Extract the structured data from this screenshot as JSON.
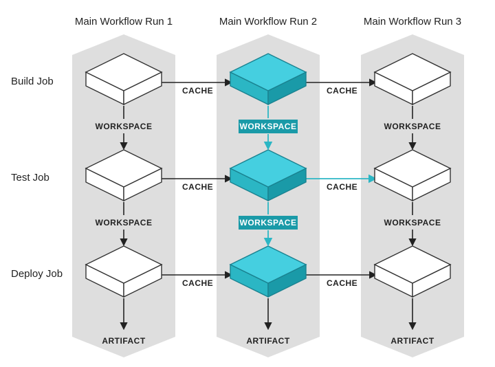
{
  "columns": [
    {
      "header": "Main Workflow Run 1"
    },
    {
      "header": "Main Workflow Run 2"
    },
    {
      "header": "Main Workflow Run 3"
    }
  ],
  "rows": [
    {
      "label": "Build Job"
    },
    {
      "label": "Test Job"
    },
    {
      "label": "Deploy Job"
    }
  ],
  "labels": {
    "cache": "CACHE",
    "workspace": "WORKSPACE",
    "artifact": "ARTIFACT"
  },
  "colors": {
    "column_bg": "#dedede",
    "accent": "#2bb6c4",
    "accent_dark": "#1a9aa8",
    "accent_top": "#45cfe0",
    "box_stroke": "#333333"
  }
}
